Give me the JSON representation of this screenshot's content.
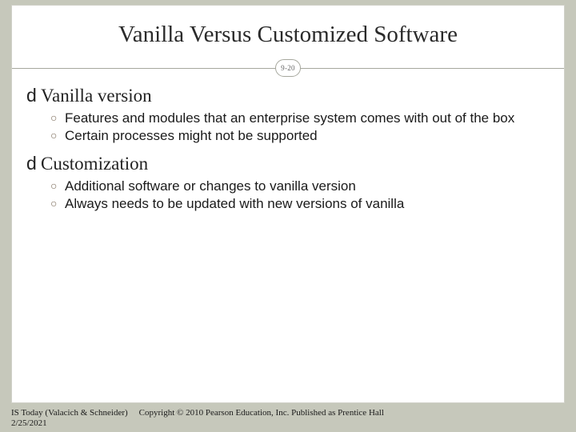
{
  "title": "Vanilla Versus Customized Software",
  "page_badge": "9-20",
  "sections": [
    {
      "heading_lead": "d",
      "heading": "Vanilla version",
      "items": [
        "Features and modules that an enterprise system comes with out of the box",
        "Certain processes might not be supported"
      ]
    },
    {
      "heading_lead": "d",
      "heading": "Customization",
      "items": [
        "Additional software or changes to vanilla version",
        "Always needs to be updated with new versions of vanilla"
      ]
    }
  ],
  "footer": {
    "source": "IS Today (Valacich & Schneider)",
    "copyright": "Copyright © 2010 Pearson Education, Inc. Published as Prentice Hall",
    "date": "2/25/2021"
  }
}
